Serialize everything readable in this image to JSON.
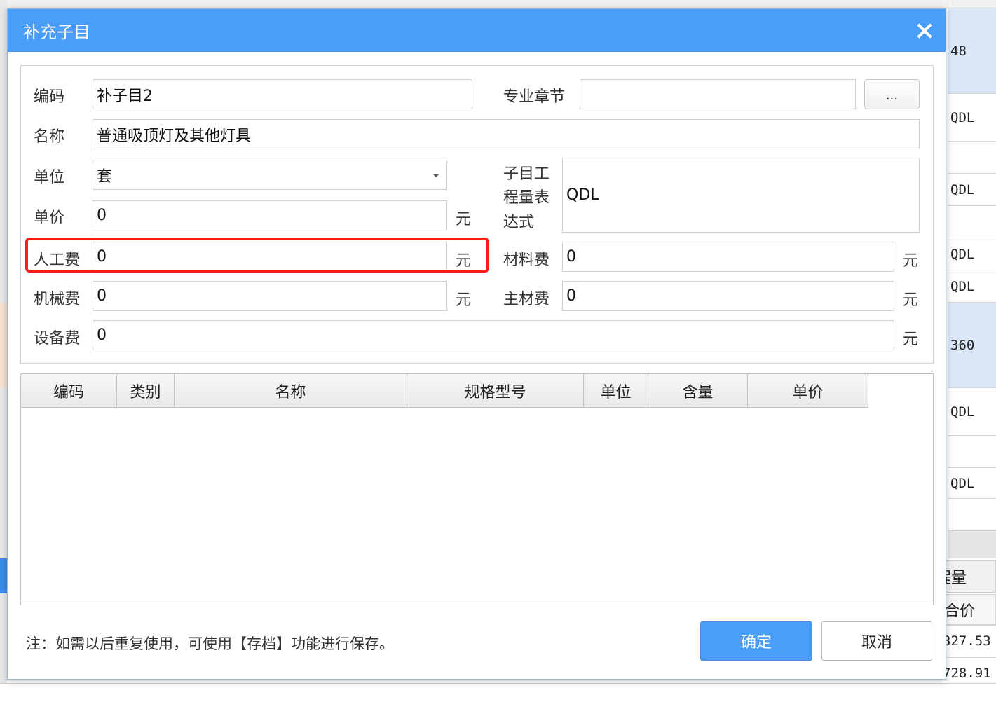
{
  "background": {
    "right_column": [
      "48",
      "QDL",
      "",
      "QDL",
      "",
      "QDL",
      "QDL",
      "360",
      "QDL",
      "",
      "QDL"
    ],
    "header_partial": "程量",
    "subheader_partial": "合价",
    "values": [
      "327.53",
      "728.91"
    ]
  },
  "dialog": {
    "title": "补充子目",
    "fields": {
      "code_label": "编码",
      "code_value": "补子目2",
      "chapter_label": "专业章节",
      "chapter_value": "",
      "browse_label": "...",
      "name_label": "名称",
      "name_value": "普通吸顶灯及其他灯具",
      "unit_label": "单位",
      "unit_value": "套",
      "price_label": "单价",
      "price_value": "0",
      "expr_label_1": "子目工",
      "expr_label_2": "程量表",
      "expr_label_3": "达式",
      "expr_value": "QDL",
      "labor_label": "人工费",
      "labor_value": "0",
      "material_label": "材料费",
      "material_value": "0",
      "machine_label": "机械费",
      "machine_value": "0",
      "main_material_label": "主材费",
      "main_material_value": "0",
      "equipment_label": "设备费",
      "equipment_value": "0",
      "currency": "元"
    },
    "grid": {
      "columns": [
        "编码",
        "类别",
        "名称",
        "规格型号",
        "单位",
        "含量",
        "单价"
      ]
    },
    "note": "注：如需以后重复使用，可使用【存档】功能进行保存。",
    "ok_label": "确定",
    "cancel_label": "取消"
  },
  "colors": {
    "titlebar": "#4a9df8",
    "highlight": "#ff1b1b"
  }
}
